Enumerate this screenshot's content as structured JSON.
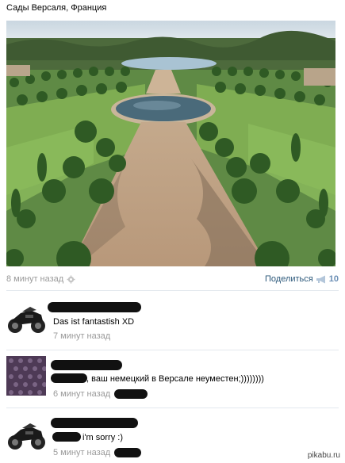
{
  "post": {
    "title": "Сады Версаля, Франция",
    "time": "8 минут назад",
    "share_label": "Поделиться",
    "share_count": "10"
  },
  "comments": [
    {
      "text": "Das ist fantastish XD",
      "time": "7 минут назад"
    },
    {
      "text": ", ваш немецкий в Версале неуместен;))))))))",
      "time": "6 минут назад"
    },
    {
      "text": "i'm sorry :)",
      "time": "5 минут назад"
    }
  ],
  "watermark": "pikabu.ru",
  "icons": {
    "time": "gear-icon",
    "share": "megaphone-icon"
  },
  "colors": {
    "link": "#2b587a",
    "muted": "#9a9a9a",
    "share_count": "#6b8fb5"
  }
}
